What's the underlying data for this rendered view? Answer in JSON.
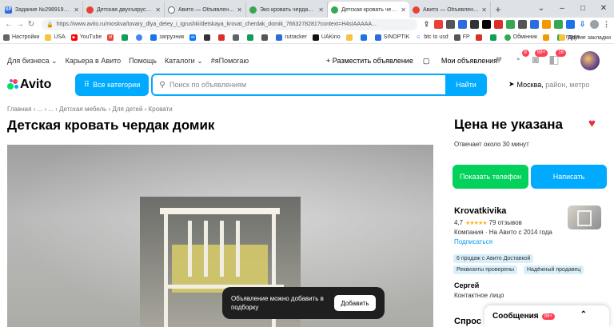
{
  "browser": {
    "tabs": [
      {
        "title": "Задание №2989193 - пр",
        "icon_color": "#2d6cdf",
        "icon_text": "SP"
      },
      {
        "title": "Детская двухъярусная",
        "icon_color": "#e94235",
        "icon_text": ""
      },
      {
        "title": "Авито — Объявления н",
        "icon_color": "#5f6368",
        "icon_text": ""
      },
      {
        "title": "Эко кровать чердак из",
        "icon_color": "#34a853",
        "icon_text": ""
      },
      {
        "title": "Детская кровать черда",
        "icon_color": "#34a853",
        "icon_text": ""
      },
      {
        "title": "Авито — Объявления н",
        "icon_color": "#e94235",
        "icon_text": ""
      }
    ],
    "url": "https://www.avito.ru/moskva/tovary_dlya_detey_i_igrushki/detskaya_krovat_cherdak_domik_7663278281?context=H4sIAAAAA...",
    "bookmarks": [
      "Настройки",
      "USA",
      "YouTube",
      "",
      "",
      "",
      "загрузник",
      "",
      "",
      "",
      "",
      "",
      "",
      "rutracker",
      "UAKino",
      "",
      "",
      "SINOPTIK",
      "btc to usd",
      "FP",
      "",
      "",
      "Обмінник",
      "",
      "maps"
    ],
    "other_bookmarks": "Другие закладки"
  },
  "nav": {
    "for_business": "Для бизнеса",
    "career": "Карьера в Авито",
    "help": "Помощь",
    "catalogs": "Каталоги",
    "ya_pomogayu": "#яПомогаю",
    "post_ad": "+ Разместить объявление",
    "my_ads": "Мои объявления",
    "badge_1": "8",
    "badge_2": "99+",
    "badge_3": "16"
  },
  "search": {
    "logo": "Avito",
    "categories": "Все категории",
    "placeholder": "Поиск по объявлениям",
    "find": "Найти",
    "city": "Москва,",
    "city_hint": "район, метро"
  },
  "listing": {
    "breadcrumbs": "Главная › ... › ... › Детская мебель › Для детей › Кровати",
    "title": "Детская кровать чердак домик",
    "price": "Цена не указана",
    "posted": "Отвечает около 30 минут",
    "show_phone": "Показать телефон",
    "write": "Написать"
  },
  "seller": {
    "name": "Krovatkivika",
    "rating": "4,7",
    "reviews": "79 отзывов",
    "company": "Компания · На Авито с 2014 года",
    "subscribe": "Подписаться",
    "chips": [
      "6 продаж с Авито Доставкой",
      "Реквизиты проверены",
      "Надёжный продавец"
    ],
    "contact_name": "Сергей",
    "contact_role": "Контактное лицо",
    "ask": "Спрос"
  },
  "toast": {
    "text": "Объявление можно добавить в подборку",
    "button": "Добавить"
  },
  "messenger": {
    "title": "Сообщения",
    "badge": "99+"
  },
  "colors": {
    "accent": "#00aaff",
    "green": "#02d15c",
    "heart": "#e8303f",
    "badge": "#ff4053"
  }
}
